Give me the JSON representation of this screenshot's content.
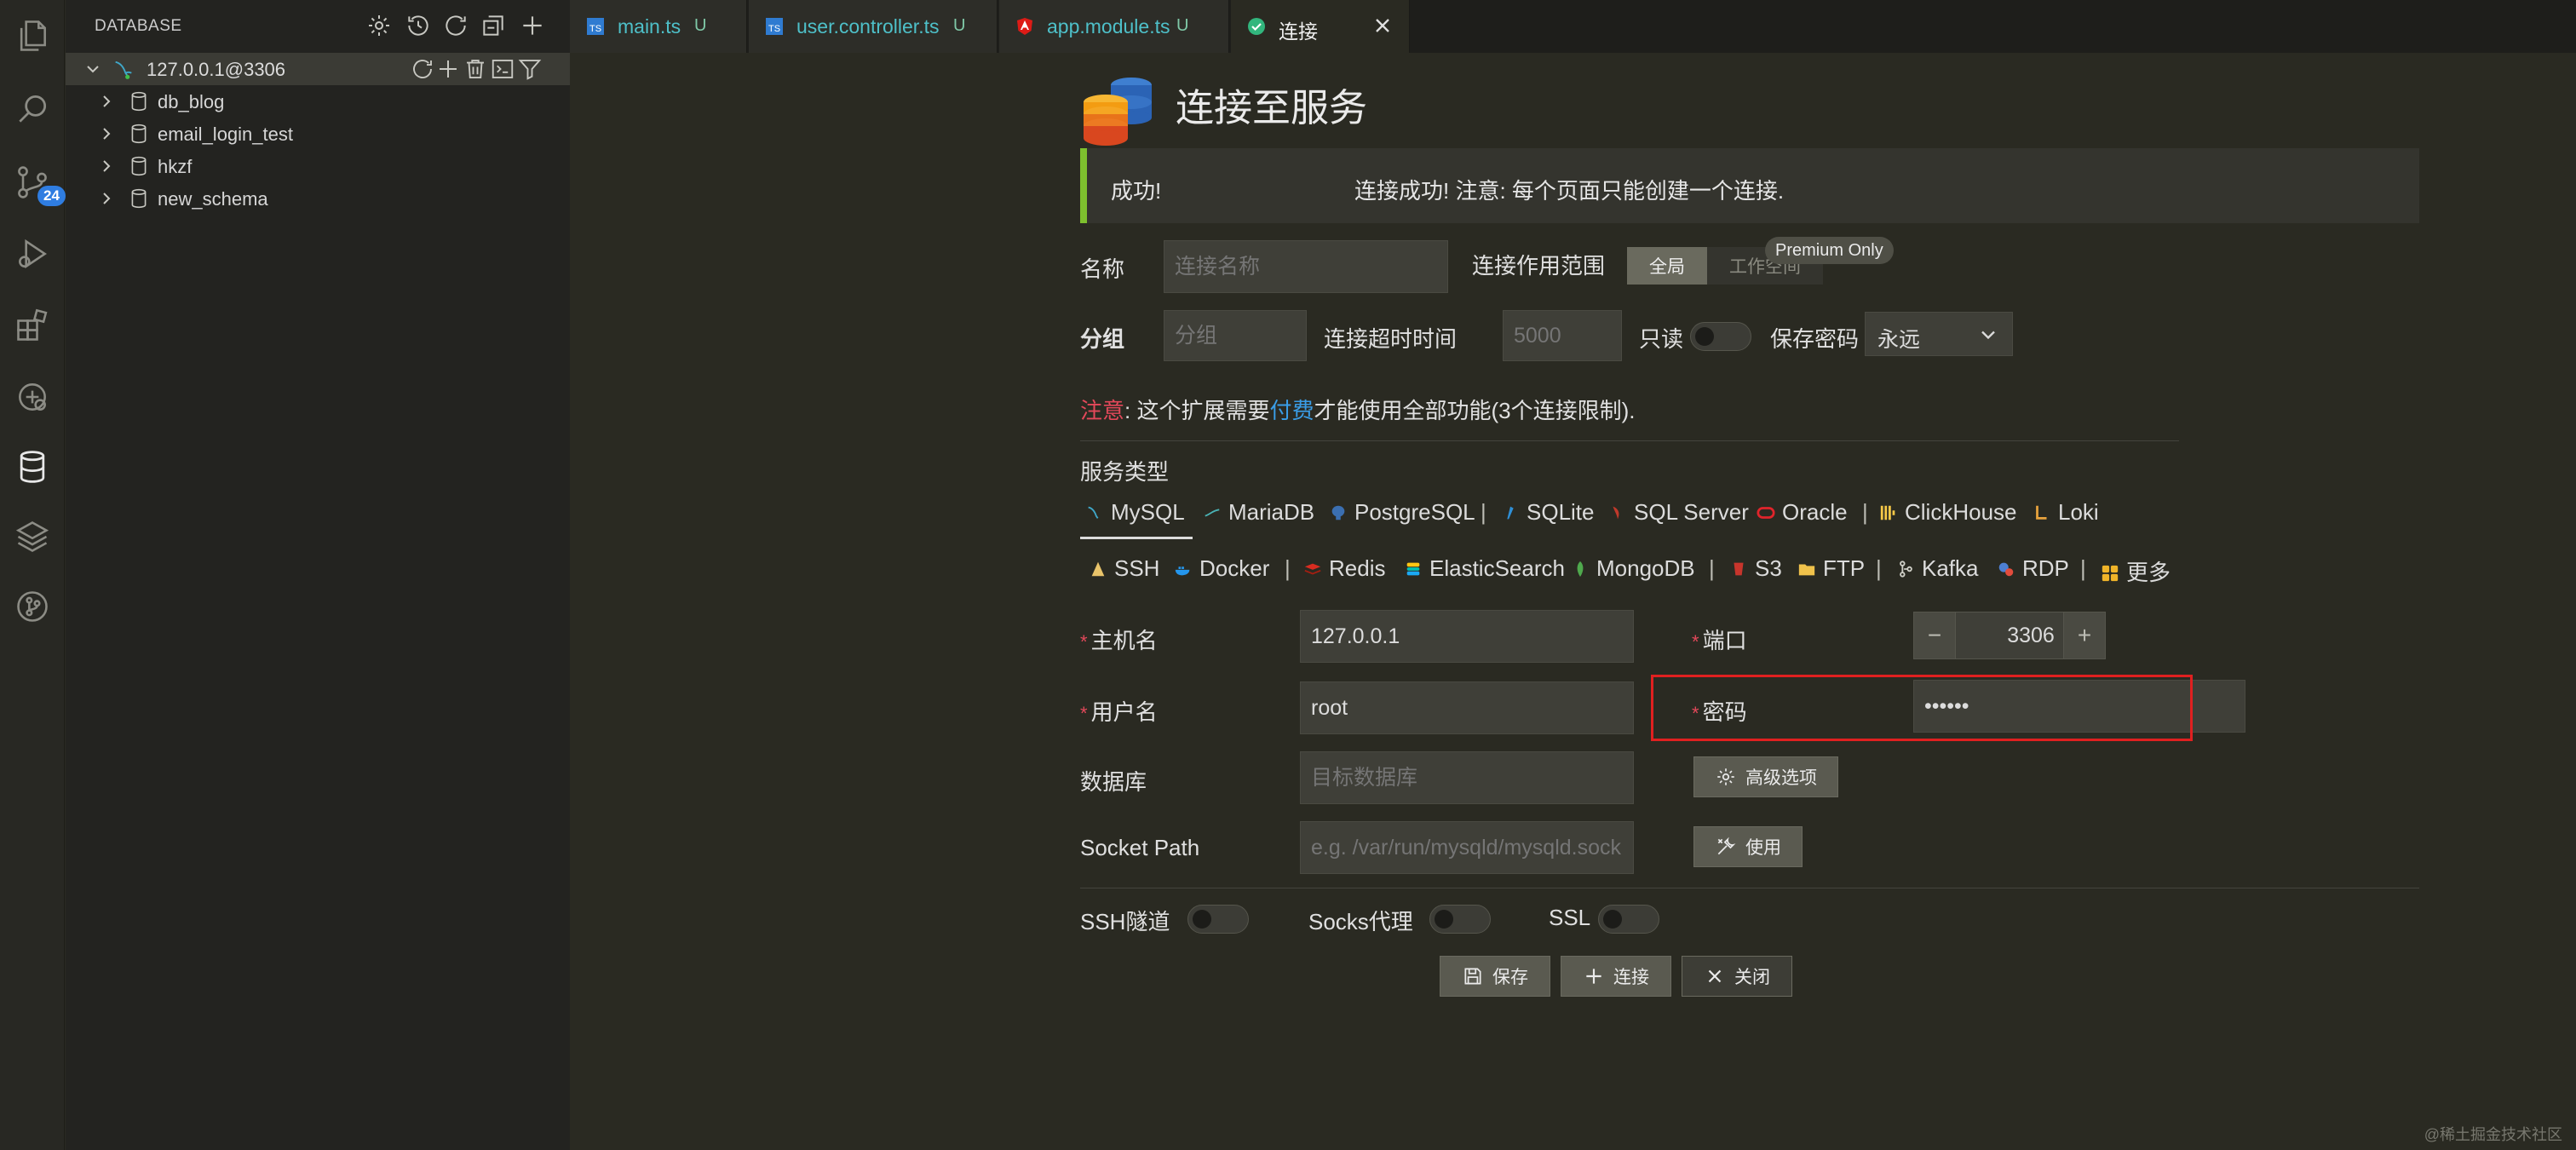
{
  "sidebar": {
    "title": "DATABASE",
    "connection": {
      "label": "127.0.0.1@3306"
    },
    "databases": [
      {
        "label": "db_blog"
      },
      {
        "label": "email_login_test"
      },
      {
        "label": "hkzf"
      },
      {
        "label": "new_schema"
      }
    ]
  },
  "activity": {
    "scm_badge": "24"
  },
  "tabs": [
    {
      "label": "main.ts",
      "status": "U",
      "icon": "typescript-icon"
    },
    {
      "label": "user.controller.ts",
      "status": "U",
      "icon": "typescript-icon"
    },
    {
      "label": "app.module.ts",
      "status": "U",
      "icon": "angular-icon"
    },
    {
      "label": "连接",
      "icon": "check-circle-icon",
      "active": true
    }
  ],
  "form": {
    "title": "连接至服务",
    "alert": {
      "title": "成功!",
      "message": "连接成功! 注意: 每个页面只能创建一个连接."
    },
    "name": {
      "label": "名称",
      "placeholder": "连接名称",
      "value": ""
    },
    "scope": {
      "label": "连接作用范围",
      "options": [
        "全局",
        "工作空间"
      ],
      "selected": "全局",
      "premium_tag": "Premium Only"
    },
    "group": {
      "label": "分组",
      "placeholder": "分组",
      "value": ""
    },
    "timeout": {
      "label": "连接超时时间",
      "placeholder": "5000"
    },
    "readonly": {
      "label": "只读",
      "on": false
    },
    "save_password": {
      "label": "保存密码",
      "value": "永远"
    },
    "note": {
      "prefix": "注意",
      "text1": ": 这个扩展需要",
      "link": "付费",
      "text2": "才能使用全部功能(3个连接限制)."
    },
    "service_type": {
      "label": "服务类型",
      "selected": "MySQL",
      "row1": [
        "MySQL",
        "MariaDB",
        "PostgreSQL",
        "SQLite",
        "SQL Server",
        "Oracle",
        "ClickHouse",
        "Loki"
      ],
      "row2": [
        "SSH",
        "Docker",
        "Redis",
        "ElasticSearch",
        "MongoDB",
        "S3",
        "FTP",
        "Kafka",
        "RDP",
        "更多"
      ]
    },
    "host": {
      "label": "主机名",
      "value": "127.0.0.1"
    },
    "port": {
      "label": "端口",
      "value": "3306",
      "minus": "−",
      "plus": "+"
    },
    "username": {
      "label": "用户名",
      "value": "root"
    },
    "password": {
      "label": "密码",
      "value": "••••••"
    },
    "database": {
      "label": "数据库",
      "placeholder": "目标数据库"
    },
    "advanced_button": "高级选项",
    "socket": {
      "label": "Socket Path",
      "placeholder": "e.g. /var/run/mysqld/mysqld.sock"
    },
    "use_button": "使用",
    "ssh_tunnel": {
      "label": "SSH隧道",
      "on": false
    },
    "socks_proxy": {
      "label": "Socks代理",
      "on": false
    },
    "ssl": {
      "label": "SSL",
      "on": false
    },
    "buttons": {
      "save": "保存",
      "connect": "连接",
      "close": "关闭"
    }
  },
  "watermark": "@稀土掘金技术社区",
  "colors": {
    "accent_green": "#7ec02e",
    "required_red": "#e3485a",
    "link_blue": "#3a9de6",
    "highlight_red": "#e02020"
  }
}
